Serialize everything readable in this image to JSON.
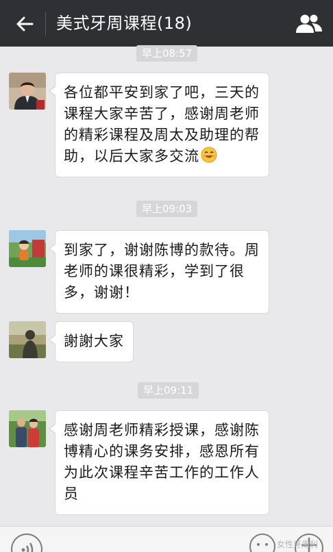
{
  "header": {
    "title": "美式牙周课程(18)",
    "back_icon": "back-arrow-icon",
    "members_icon": "group-members-icon",
    "bg_color": "#2f3034"
  },
  "messages": [
    {
      "time": "早上08:57",
      "sender_avatar": "avatar-man-suit",
      "text_lines": [
        "各位都平安到家了吧，三天的",
        "课程大家辛苦了，感谢周老师",
        "的精彩课程及周太及助理的帮",
        "助，以后大家多交流"
      ],
      "emoji": "smile-emoji-icon"
    },
    {
      "time": "早上09:03",
      "sender_avatar": "avatar-child",
      "text_lines": [
        "到家了，谢谢陈博的款待。周",
        "老师的课很精彩，学到了很",
        "多，谢谢！"
      ]
    },
    {
      "sender_avatar": "avatar-shadow",
      "text_lines": [
        "謝謝大家"
      ]
    },
    {
      "time": "早上09:11",
      "sender_avatar": "avatar-couple",
      "text_lines": [
        "感谢周老师精彩授课，感谢陈",
        "博精心的课务安排，感恩所有",
        "为此次课程辛苦工作的工作人",
        "员"
      ]
    }
  ],
  "input_bar": {
    "voice_icon": "voice-icon",
    "emoji_icon": "emoji-icon",
    "plus_icon": "plus-icon"
  },
  "watermark": "女性牙周利"
}
